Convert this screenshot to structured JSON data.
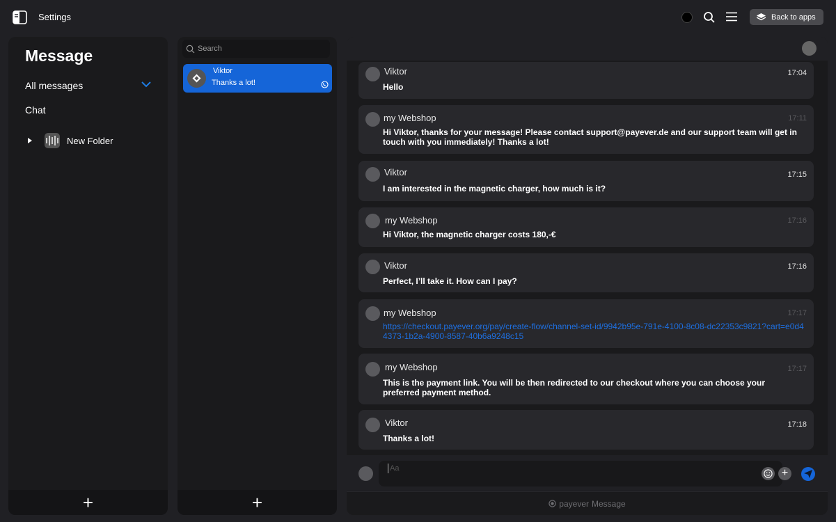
{
  "topbar": {
    "title": "Settings",
    "back_label": "Back to apps"
  },
  "left": {
    "title": "Message",
    "nav_all": "All messages",
    "nav_chat": "Chat",
    "folder_label": "New Folder"
  },
  "middle": {
    "search_placeholder": "Search",
    "contact": {
      "name": "Viktor",
      "last_message": "Thanks a lot!"
    }
  },
  "chat": {
    "messages": [
      {
        "sender": "Viktor",
        "time": "17:04",
        "text": "Hello"
      },
      {
        "sender": "my Webshop",
        "time": "17:11",
        "text": "Hi Viktor, thanks for your message! Please contact support@payever.de and our support team will get in touch with you immediately! Thanks a lot!"
      },
      {
        "sender": "Viktor",
        "time": "17:15",
        "text": "I am interested in the magnetic charger, how much is it?"
      },
      {
        "sender": "my Webshop",
        "time": "17:16",
        "text": "Hi Viktor, the magnetic charger costs 180,-€"
      },
      {
        "sender": "Viktor",
        "time": "17:16",
        "text": "Perfect, I’ll take it. How can I pay?"
      },
      {
        "sender": "my Webshop",
        "time": "17:17",
        "text": "https://checkout.payever.org/pay/create-flow/channel-set-id/9942b95e-791e-4100-8c08-dc22353c9821?cart=e0d44373-1b2a-4900-8587-40b6a9248c15"
      },
      {
        "sender": "my Webshop",
        "time": "17:17",
        "text": "This is the payment link. You will be then redirected to our checkout where you can choose your preferred payment method."
      },
      {
        "sender": "Viktor",
        "time": "17:18",
        "text": "Thanks a lot!"
      }
    ],
    "composer_placeholder": "Aa",
    "brand_label": "payever",
    "brand_app": "Message"
  },
  "colors": {
    "accent": "#1565d8",
    "link": "#1e6fe0",
    "background": "#202024",
    "panel": "#1a1a1c",
    "bubble": "#28282c"
  },
  "icons": [
    "sidebar-toggle-icon",
    "search-icon",
    "menu-icon",
    "layers-icon",
    "chevron-down-icon",
    "triangle-right-icon",
    "folder-audio-icon",
    "whatsapp-icon",
    "emoji-icon",
    "plus-icon",
    "send-icon"
  ]
}
